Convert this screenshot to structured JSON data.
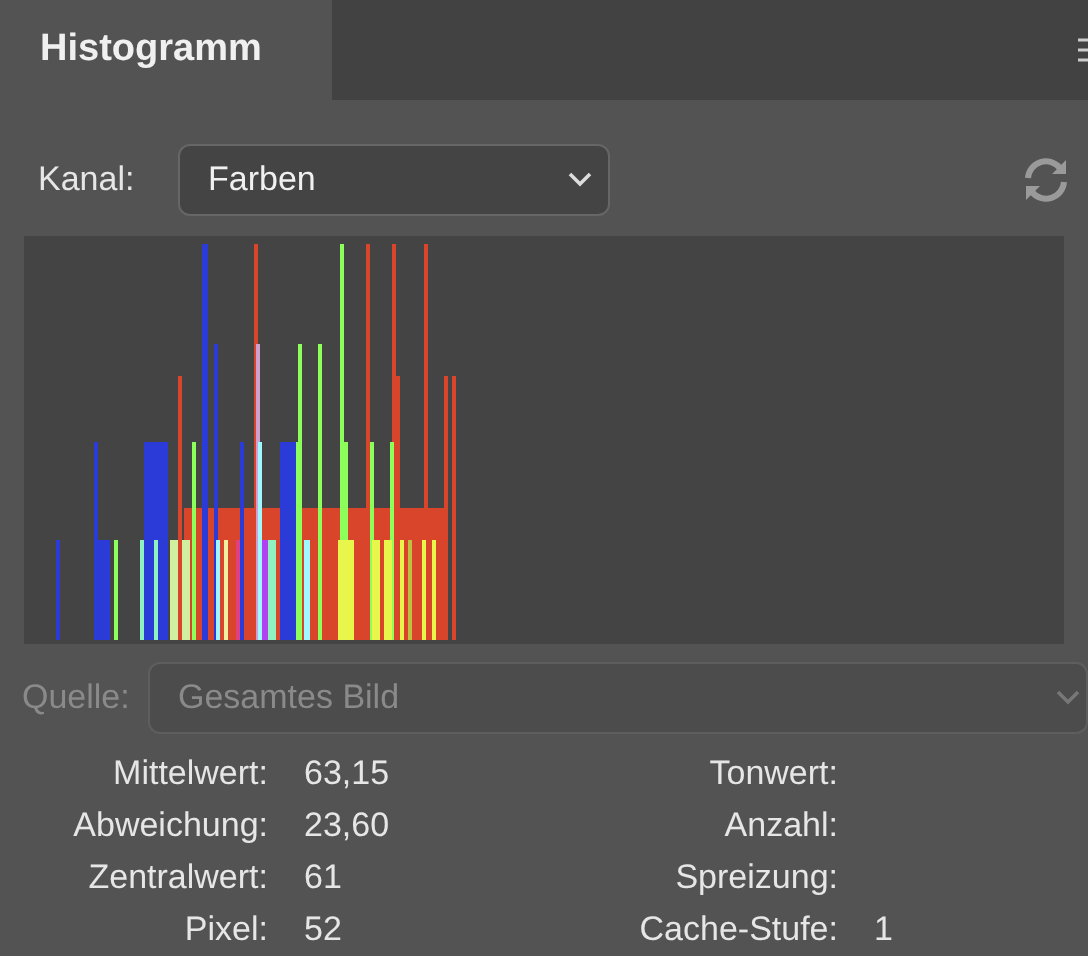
{
  "panel": {
    "tabs": [
      {
        "label": "Histogramm",
        "selected": true
      }
    ]
  },
  "channel": {
    "label": "Kanal:",
    "value": "Farben"
  },
  "source": {
    "label": "Quelle:",
    "value": "Gesamtes Bild",
    "disabled": true
  },
  "stats_left": [
    {
      "label": "Mittelwert:",
      "value": "63,15"
    },
    {
      "label": "Abweichung:",
      "value": "23,60"
    },
    {
      "label": "Zentralwert:",
      "value": "61"
    },
    {
      "label": "Pixel:",
      "value": "52"
    }
  ],
  "stats_right": [
    {
      "label": "Tonwert:"
    },
    {
      "label": "Anzahl:"
    },
    {
      "label": "Spreizung:"
    },
    {
      "label": "Cache-Stufe:",
      "value": "1"
    }
  ]
}
